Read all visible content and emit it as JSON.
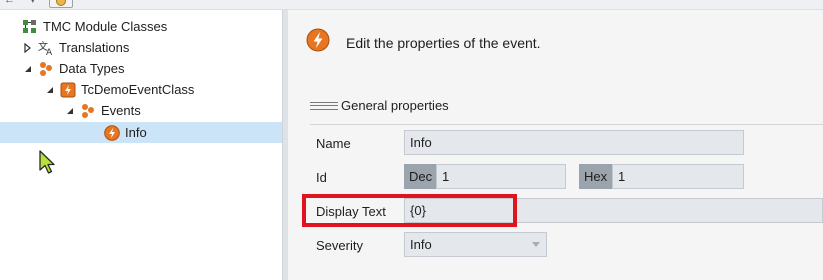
{
  "tree": {
    "items": [
      {
        "label": "TMC Module Classes",
        "expander": "none",
        "icon": "module-classes-icon"
      },
      {
        "label": "Translations",
        "expander": "collapsed",
        "icon": "translations-icon"
      },
      {
        "label": "Data Types",
        "expander": "expanded",
        "icon": "data-types-icon"
      },
      {
        "label": "TcDemoEventClass",
        "expander": "expanded",
        "icon": "event-class-icon"
      },
      {
        "label": "Events",
        "expander": "expanded",
        "icon": "events-icon"
      },
      {
        "label": "Info",
        "expander": "none",
        "icon": "event-lightning-icon",
        "selected": true
      }
    ]
  },
  "header": {
    "icon": "event-lightning-icon",
    "text": "Edit the properties of the event."
  },
  "group": {
    "title": "General properties"
  },
  "fields": {
    "name": {
      "label": "Name",
      "value": "Info"
    },
    "id": {
      "label": "Id",
      "dec_tag": "Dec",
      "dec_value": "1",
      "hex_tag": "Hex",
      "hex_value": "1"
    },
    "display_text": {
      "label": "Display Text",
      "value": "{0}"
    },
    "severity": {
      "label": "Severity",
      "value": "Info",
      "icon": "chevron-down-icon"
    }
  },
  "colors": {
    "accent_orange": "#e8751f",
    "selection": "#cce4f7",
    "highlight_red": "#e0141e"
  }
}
